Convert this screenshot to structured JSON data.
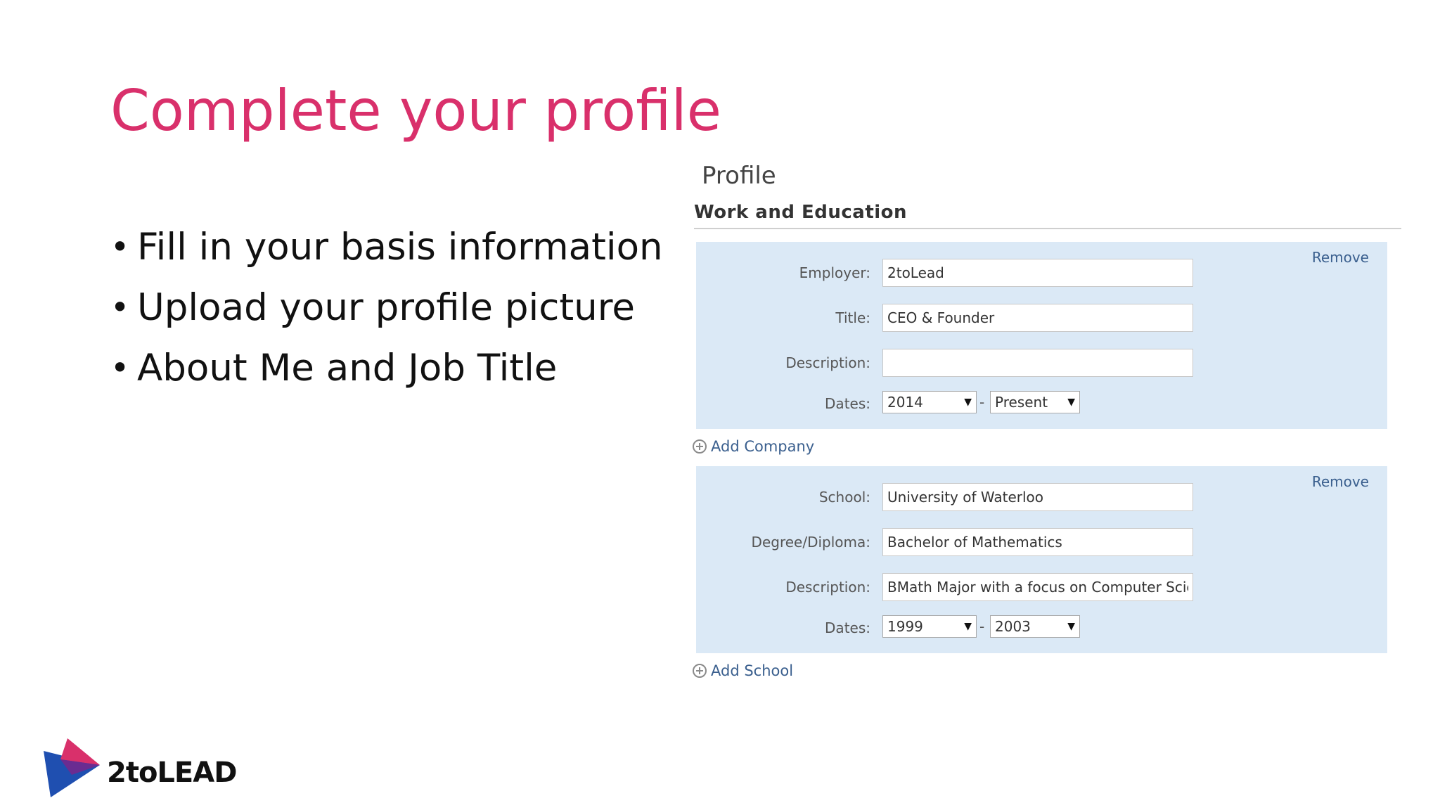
{
  "slide": {
    "title": "Complete your profile",
    "bullets": [
      "Fill in your basis information",
      "Upload your profile picture",
      "About Me and Job Title"
    ]
  },
  "profile": {
    "heading": "Profile",
    "section": "Work and Education",
    "company": {
      "remove": "Remove",
      "employer_label": "Employer:",
      "employer_value": "2toLead",
      "title_label": "Title:",
      "title_value": "CEO & Founder",
      "description_label": "Description:",
      "description_value": "",
      "dates_label": "Dates:",
      "start": "2014",
      "end": "Present"
    },
    "add_company": "Add Company",
    "school": {
      "remove": "Remove",
      "school_label": "School:",
      "school_value": "University of Waterloo",
      "degree_label": "Degree/Diploma:",
      "degree_value": "Bachelor of Mathematics",
      "description_label": "Description:",
      "description_value": "BMath Major with a focus on Computer Science",
      "dates_label": "Dates:",
      "start": "1999",
      "end": "2003"
    },
    "add_school": "Add School",
    "dash": "-"
  },
  "logo": {
    "text": "2toLEAD"
  },
  "colors": {
    "title": "#d9306b",
    "panel": "#dbe9f6",
    "link": "#3a5f8e"
  }
}
